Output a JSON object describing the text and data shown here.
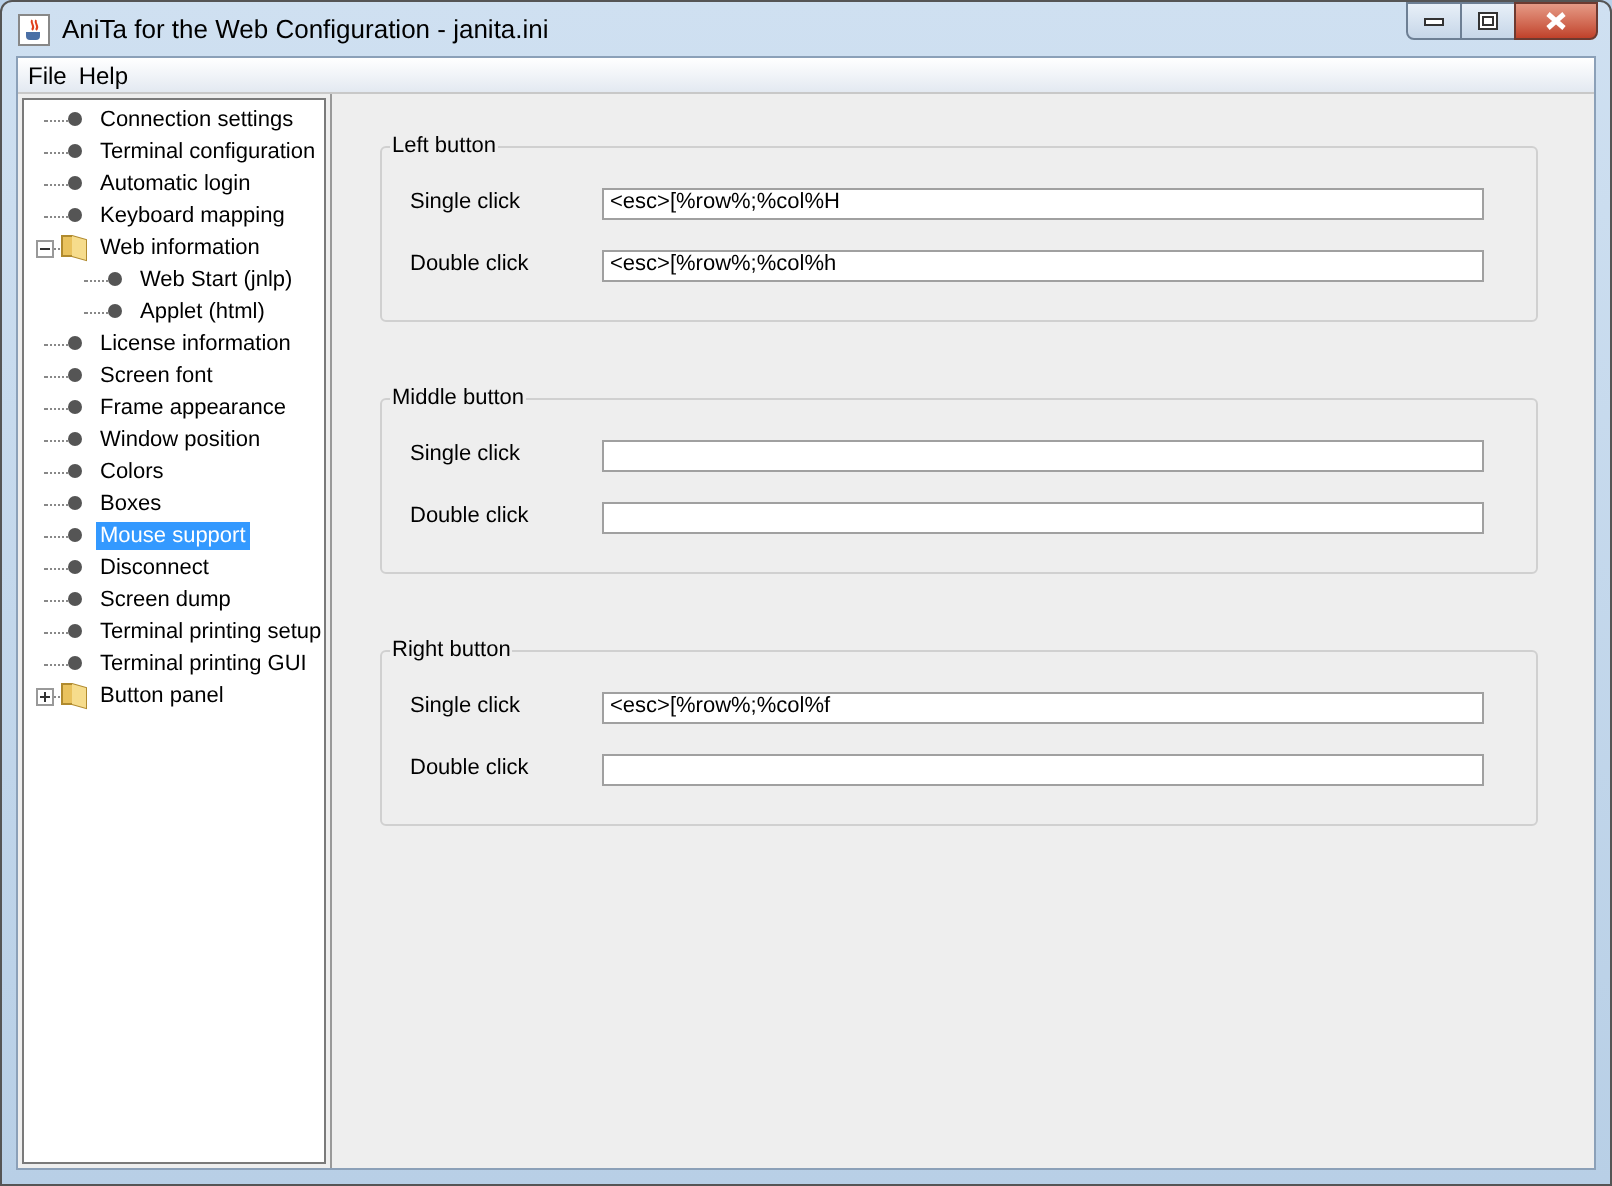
{
  "window": {
    "title": "AniTa for the Web Configuration - janita.ini"
  },
  "menu": [
    "File",
    "Help"
  ],
  "tree": [
    {
      "label": "Connection settings",
      "kind": "leaf",
      "selected": false
    },
    {
      "label": "Terminal configuration",
      "kind": "leaf",
      "selected": false
    },
    {
      "label": "Automatic login",
      "kind": "leaf",
      "selected": false
    },
    {
      "label": "Keyboard mapping",
      "kind": "leaf",
      "selected": false
    },
    {
      "label": "Web information",
      "kind": "folder",
      "expanded": true,
      "selected": false,
      "children": [
        {
          "label": "Web Start (jnlp)",
          "kind": "leaf",
          "selected": false
        },
        {
          "label": "Applet (html)",
          "kind": "leaf",
          "selected": false
        }
      ]
    },
    {
      "label": "License information",
      "kind": "leaf",
      "selected": false
    },
    {
      "label": "Screen font",
      "kind": "leaf",
      "selected": false
    },
    {
      "label": "Frame appearance",
      "kind": "leaf",
      "selected": false
    },
    {
      "label": "Window position",
      "kind": "leaf",
      "selected": false
    },
    {
      "label": "Colors",
      "kind": "leaf",
      "selected": false
    },
    {
      "label": "Boxes",
      "kind": "leaf",
      "selected": false
    },
    {
      "label": "Mouse support",
      "kind": "leaf",
      "selected": true
    },
    {
      "label": "Disconnect",
      "kind": "leaf",
      "selected": false
    },
    {
      "label": "Screen dump",
      "kind": "leaf",
      "selected": false
    },
    {
      "label": "Terminal printing setup",
      "kind": "leaf",
      "selected": false
    },
    {
      "label": "Terminal printing GUI",
      "kind": "leaf",
      "selected": false
    },
    {
      "label": "Button panel",
      "kind": "folder",
      "expanded": false,
      "selected": false
    }
  ],
  "groups": [
    {
      "title": "Left button",
      "fields": [
        {
          "label": "Single click",
          "value": "<esc>[%row%;%col%H"
        },
        {
          "label": "Double click",
          "value": "<esc>[%row%;%col%h"
        }
      ]
    },
    {
      "title": "Middle button",
      "fields": [
        {
          "label": "Single click"
        },
        {
          "label": "Double click"
        }
      ]
    },
    {
      "title": "Right button",
      "fields": [
        {
          "label": "Single click",
          "value": "<esc>[%row%;%col%f"
        },
        {
          "label": "Double click"
        }
      ]
    }
  ]
}
